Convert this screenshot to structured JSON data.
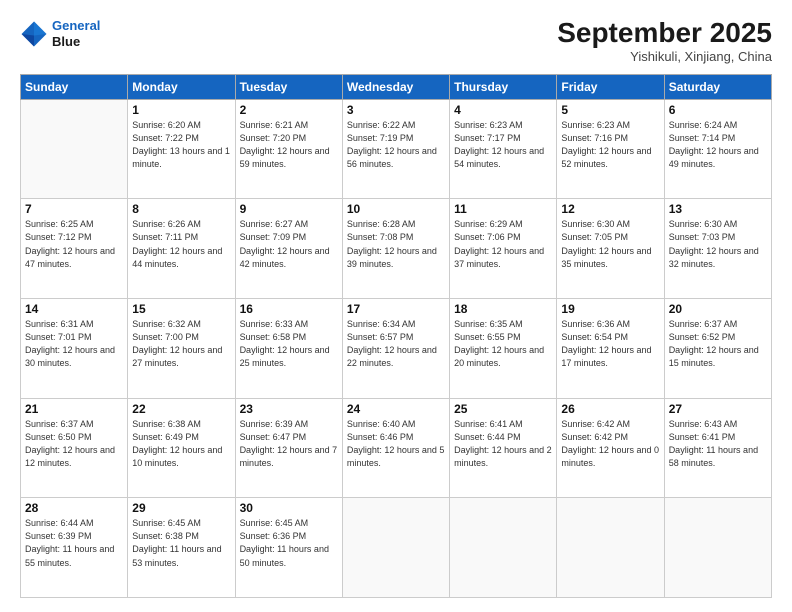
{
  "header": {
    "logo_line1": "General",
    "logo_line2": "Blue",
    "month_title": "September 2025",
    "location": "Yishikuli, Xinjiang, China"
  },
  "weekdays": [
    "Sunday",
    "Monday",
    "Tuesday",
    "Wednesday",
    "Thursday",
    "Friday",
    "Saturday"
  ],
  "weeks": [
    [
      {
        "day": "",
        "info": ""
      },
      {
        "day": "1",
        "info": "Sunrise: 6:20 AM\nSunset: 7:22 PM\nDaylight: 13 hours\nand 1 minute."
      },
      {
        "day": "2",
        "info": "Sunrise: 6:21 AM\nSunset: 7:20 PM\nDaylight: 12 hours\nand 59 minutes."
      },
      {
        "day": "3",
        "info": "Sunrise: 6:22 AM\nSunset: 7:19 PM\nDaylight: 12 hours\nand 56 minutes."
      },
      {
        "day": "4",
        "info": "Sunrise: 6:23 AM\nSunset: 7:17 PM\nDaylight: 12 hours\nand 54 minutes."
      },
      {
        "day": "5",
        "info": "Sunrise: 6:23 AM\nSunset: 7:16 PM\nDaylight: 12 hours\nand 52 minutes."
      },
      {
        "day": "6",
        "info": "Sunrise: 6:24 AM\nSunset: 7:14 PM\nDaylight: 12 hours\nand 49 minutes."
      }
    ],
    [
      {
        "day": "7",
        "info": "Sunrise: 6:25 AM\nSunset: 7:12 PM\nDaylight: 12 hours\nand 47 minutes."
      },
      {
        "day": "8",
        "info": "Sunrise: 6:26 AM\nSunset: 7:11 PM\nDaylight: 12 hours\nand 44 minutes."
      },
      {
        "day": "9",
        "info": "Sunrise: 6:27 AM\nSunset: 7:09 PM\nDaylight: 12 hours\nand 42 minutes."
      },
      {
        "day": "10",
        "info": "Sunrise: 6:28 AM\nSunset: 7:08 PM\nDaylight: 12 hours\nand 39 minutes."
      },
      {
        "day": "11",
        "info": "Sunrise: 6:29 AM\nSunset: 7:06 PM\nDaylight: 12 hours\nand 37 minutes."
      },
      {
        "day": "12",
        "info": "Sunrise: 6:30 AM\nSunset: 7:05 PM\nDaylight: 12 hours\nand 35 minutes."
      },
      {
        "day": "13",
        "info": "Sunrise: 6:30 AM\nSunset: 7:03 PM\nDaylight: 12 hours\nand 32 minutes."
      }
    ],
    [
      {
        "day": "14",
        "info": "Sunrise: 6:31 AM\nSunset: 7:01 PM\nDaylight: 12 hours\nand 30 minutes."
      },
      {
        "day": "15",
        "info": "Sunrise: 6:32 AM\nSunset: 7:00 PM\nDaylight: 12 hours\nand 27 minutes."
      },
      {
        "day": "16",
        "info": "Sunrise: 6:33 AM\nSunset: 6:58 PM\nDaylight: 12 hours\nand 25 minutes."
      },
      {
        "day": "17",
        "info": "Sunrise: 6:34 AM\nSunset: 6:57 PM\nDaylight: 12 hours\nand 22 minutes."
      },
      {
        "day": "18",
        "info": "Sunrise: 6:35 AM\nSunset: 6:55 PM\nDaylight: 12 hours\nand 20 minutes."
      },
      {
        "day": "19",
        "info": "Sunrise: 6:36 AM\nSunset: 6:54 PM\nDaylight: 12 hours\nand 17 minutes."
      },
      {
        "day": "20",
        "info": "Sunrise: 6:37 AM\nSunset: 6:52 PM\nDaylight: 12 hours\nand 15 minutes."
      }
    ],
    [
      {
        "day": "21",
        "info": "Sunrise: 6:37 AM\nSunset: 6:50 PM\nDaylight: 12 hours\nand 12 minutes."
      },
      {
        "day": "22",
        "info": "Sunrise: 6:38 AM\nSunset: 6:49 PM\nDaylight: 12 hours\nand 10 minutes."
      },
      {
        "day": "23",
        "info": "Sunrise: 6:39 AM\nSunset: 6:47 PM\nDaylight: 12 hours\nand 7 minutes."
      },
      {
        "day": "24",
        "info": "Sunrise: 6:40 AM\nSunset: 6:46 PM\nDaylight: 12 hours\nand 5 minutes."
      },
      {
        "day": "25",
        "info": "Sunrise: 6:41 AM\nSunset: 6:44 PM\nDaylight: 12 hours\nand 2 minutes."
      },
      {
        "day": "26",
        "info": "Sunrise: 6:42 AM\nSunset: 6:42 PM\nDaylight: 12 hours\nand 0 minutes."
      },
      {
        "day": "27",
        "info": "Sunrise: 6:43 AM\nSunset: 6:41 PM\nDaylight: 11 hours\nand 58 minutes."
      }
    ],
    [
      {
        "day": "28",
        "info": "Sunrise: 6:44 AM\nSunset: 6:39 PM\nDaylight: 11 hours\nand 55 minutes."
      },
      {
        "day": "29",
        "info": "Sunrise: 6:45 AM\nSunset: 6:38 PM\nDaylight: 11 hours\nand 53 minutes."
      },
      {
        "day": "30",
        "info": "Sunrise: 6:45 AM\nSunset: 6:36 PM\nDaylight: 11 hours\nand 50 minutes."
      },
      {
        "day": "",
        "info": ""
      },
      {
        "day": "",
        "info": ""
      },
      {
        "day": "",
        "info": ""
      },
      {
        "day": "",
        "info": ""
      }
    ]
  ]
}
